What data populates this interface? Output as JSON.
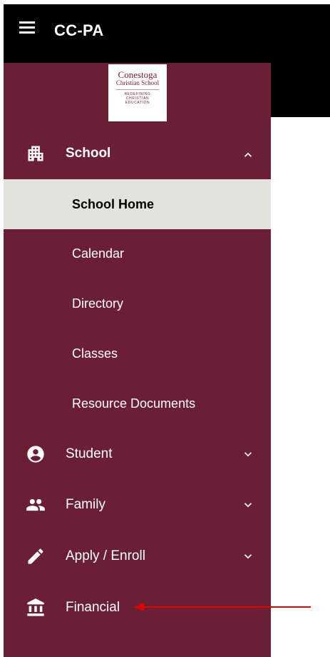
{
  "header": {
    "title": "CC-PA",
    "menu_icon": "hamburger-menu-icon"
  },
  "logo": {
    "line1": "Conestoga",
    "line2": "Christian School",
    "tagline1": "REDEFINING",
    "tagline2": "CHRISTIAN",
    "tagline3": "EDUCATION"
  },
  "sidebar": {
    "school": {
      "label": "School",
      "icon": "building-icon",
      "expanded": true
    },
    "subitems": [
      {
        "label": "School Home",
        "active": true
      },
      {
        "label": "Calendar"
      },
      {
        "label": "Directory"
      },
      {
        "label": "Classes"
      },
      {
        "label": "Resource Documents"
      }
    ],
    "student": {
      "label": "Student",
      "icon": "account-circle-icon"
    },
    "family": {
      "label": "Family",
      "icon": "people-icon"
    },
    "apply": {
      "label": "Apply / Enroll",
      "icon": "pencil-icon"
    },
    "financial": {
      "label": "Financial",
      "icon": "bank-icon"
    }
  },
  "colors": {
    "sidebar": "#6b1f34",
    "topbar": "#000000",
    "active_bg": "#e3e3de",
    "annotation_arrow": "#e00000"
  }
}
